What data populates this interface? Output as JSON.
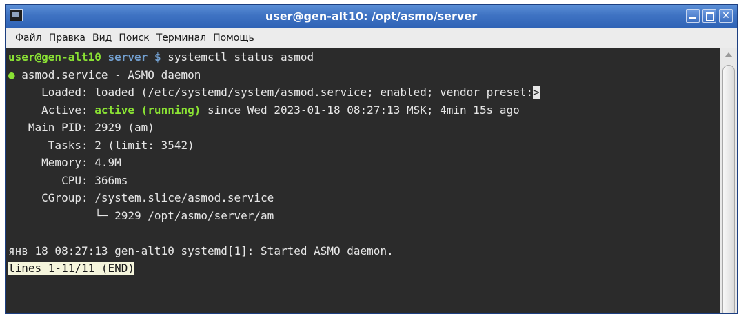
{
  "window": {
    "title": "user@gen-alt10: /opt/asmo/server"
  },
  "menu": [
    "Файл",
    "Правка",
    "Вид",
    "Поиск",
    "Терминал",
    "Помощь"
  ],
  "terminal": {
    "prompt_user": "user@gen-alt10",
    "prompt_dir": "server",
    "prompt_sign": "$",
    "command": "systemctl status asmod",
    "service_dot": "●",
    "service_line": " asmod.service - ASMO daemon",
    "loaded_line": "     Loaded: loaded (/etc/systemd/system/asmod.service; enabled; vendor preset:",
    "truncated_marker": ">",
    "active_label": "     Active: ",
    "active_state": "active (running)",
    "active_rest": " since Wed 2023-01-18 08:27:13 MSK; 4min 15s ago",
    "main_pid_line": "   Main PID: 2929 (am)",
    "tasks_line": "      Tasks: 2 (limit: 3542)",
    "memory_line": "     Memory: 4.9M",
    "cpu_line": "        CPU: 366ms",
    "cgroup_line": "     CGroup: /system.slice/asmod.service",
    "cgroup_child_line": "             └─ 2929 /opt/asmo/server/am",
    "blank_line": "",
    "log_line": "янв 18 08:27:13 gen-alt10 systemd[1]: Started ASMO daemon.",
    "pager_status": "lines 1-11/11 (END)"
  },
  "colors": {
    "titlebar": "#3f73c3",
    "terminal_bg": "#2b2b2b",
    "prompt_user": "#8ae234",
    "prompt_dir": "#729fcf",
    "active_state": "#8ae234"
  }
}
